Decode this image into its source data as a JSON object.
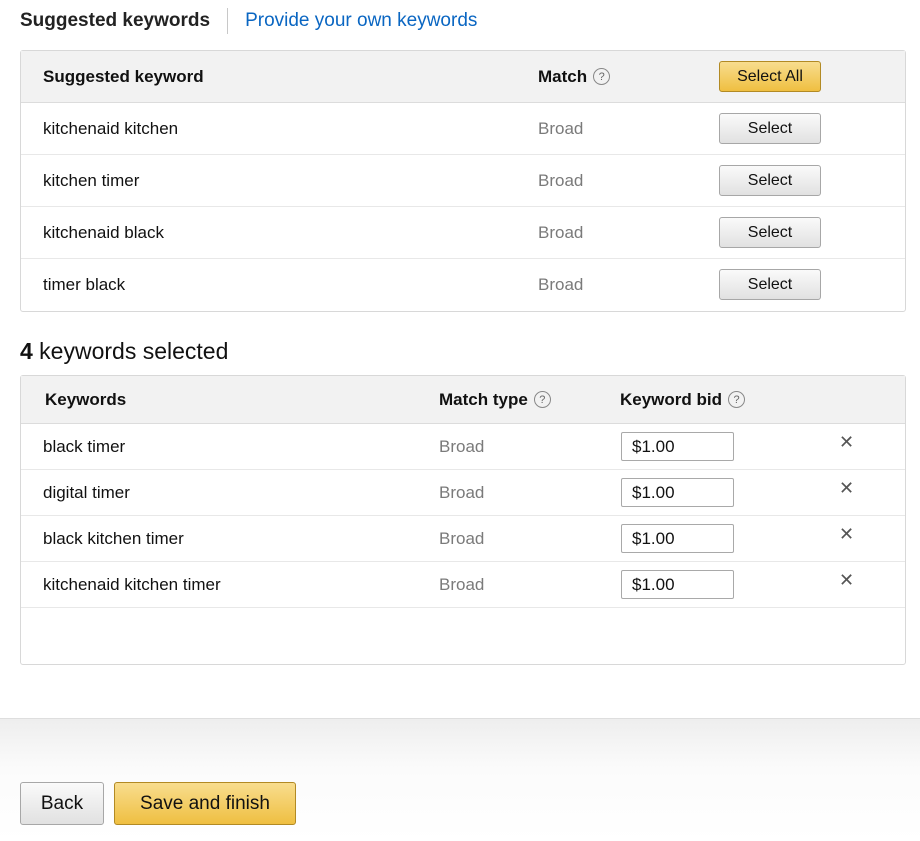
{
  "tabs": {
    "active": "Suggested keywords",
    "link": "Provide your own keywords"
  },
  "suggested": {
    "header": {
      "keyword": "Suggested keyword",
      "match": "Match",
      "select_all": "Select All"
    },
    "rows": [
      {
        "keyword": "kitchenaid kitchen",
        "match": "Broad",
        "button": "Select"
      },
      {
        "keyword": "kitchen timer",
        "match": "Broad",
        "button": "Select"
      },
      {
        "keyword": "kitchenaid black",
        "match": "Broad",
        "button": "Select"
      },
      {
        "keyword": "timer black",
        "match": "Broad",
        "button": "Select"
      }
    ]
  },
  "selected": {
    "count": "4",
    "count_label": " keywords selected",
    "header": {
      "keywords": "Keywords",
      "match_type": "Match type",
      "bid": "Keyword bid"
    },
    "rows": [
      {
        "keyword": "black timer",
        "match": "Broad",
        "bid": "$1.00"
      },
      {
        "keyword": "digital timer",
        "match": "Broad",
        "bid": "$1.00"
      },
      {
        "keyword": "black kitchen timer",
        "match": "Broad",
        "bid": "$1.00"
      },
      {
        "keyword": "kitchenaid kitchen timer",
        "match": "Broad",
        "bid": "$1.00"
      }
    ]
  },
  "icons": {
    "help": "question-circle-icon",
    "remove": "close-icon"
  },
  "footer": {
    "back": "Back",
    "save": "Save and finish"
  },
  "colors": {
    "link": "#0a66c2",
    "primary_button": "#efbf41",
    "muted_text": "#7a7a7a"
  }
}
